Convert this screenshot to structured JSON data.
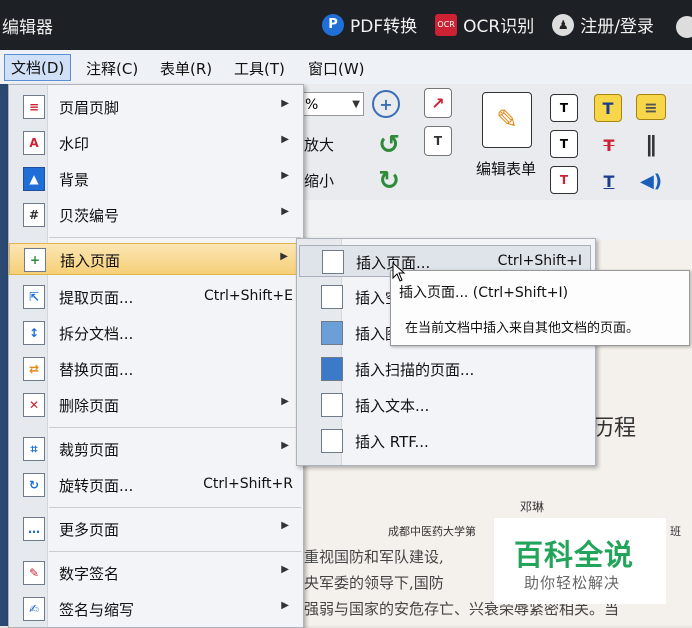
{
  "title_bar": {
    "app_title": "编辑器",
    "pdf_convert": "PDF转换",
    "ocr": "OCR识别",
    "login": "注册/登录",
    "pdf_icon_letter": "P",
    "ocr_icon_text": "OCR",
    "user_icon_letter": "♟"
  },
  "menubar": {
    "file": "文档(D)",
    "comment": "注释(C)",
    "form": "表单(R)",
    "tools": "工具(T)",
    "window": "窗口(W)"
  },
  "toolbar": {
    "zoom_value": "%",
    "zoom_in": "放大",
    "zoom_out": "缩小",
    "edit_form": "编辑表单"
  },
  "main_menu": {
    "items": [
      {
        "label": "页眉页脚",
        "icon": "header-footer-icon",
        "submenu": true
      },
      {
        "label": "水印",
        "icon": "watermark-icon",
        "submenu": true
      },
      {
        "label": "背景",
        "icon": "background-icon",
        "submenu": true
      },
      {
        "label": "贝茨编号",
        "icon": "bates-number-icon",
        "submenu": true
      },
      {
        "label": "插入页面",
        "icon": "insert-page-icon",
        "submenu": true
      },
      {
        "label": "提取页面...",
        "icon": "extract-page-icon",
        "shortcut": "Ctrl+Shift+E"
      },
      {
        "label": "拆分文档...",
        "icon": "split-document-icon"
      },
      {
        "label": "替换页面...",
        "icon": "replace-page-icon"
      },
      {
        "label": "删除页面",
        "icon": "delete-page-icon",
        "submenu": true
      },
      {
        "label": "裁剪页面",
        "icon": "crop-page-icon",
        "submenu": true
      },
      {
        "label": "旋转页面...",
        "icon": "rotate-page-icon",
        "shortcut": "Ctrl+Shift+R"
      },
      {
        "label": "更多页面",
        "icon": "more-pages-icon",
        "submenu": true
      },
      {
        "label": "数字签名",
        "icon": "digital-signature-icon",
        "submenu": true
      },
      {
        "label": "签名与缩写",
        "icon": "signature-initials-icon",
        "submenu": true
      }
    ]
  },
  "submenu": {
    "items": [
      {
        "label": "插入页面...",
        "shortcut": "Ctrl+Shift+I"
      },
      {
        "label": "插入空"
      },
      {
        "label": "插入图"
      },
      {
        "label": "插入扫描的页面..."
      },
      {
        "label": "插入文本..."
      },
      {
        "label": "插入 RTF..."
      }
    ]
  },
  "tooltip": {
    "title": "插入页面... (Ctrl+Shift+I)",
    "description": "在当前文档中插入来自其他文档的页面。"
  },
  "document": {
    "heading": "历程",
    "author": "邓琳",
    "affiliation": "成都中医药大学第",
    "affiliation_tail": "班",
    "lines": [
      "重视国防和军队建设,",
      "央军委的领导下,国防",
      "强弱与国家的安危存亡、兴衰荣辱紧密相关。当"
    ]
  },
  "watermark": {
    "brand": "百科全说",
    "subtitle": "助你轻松解决"
  }
}
